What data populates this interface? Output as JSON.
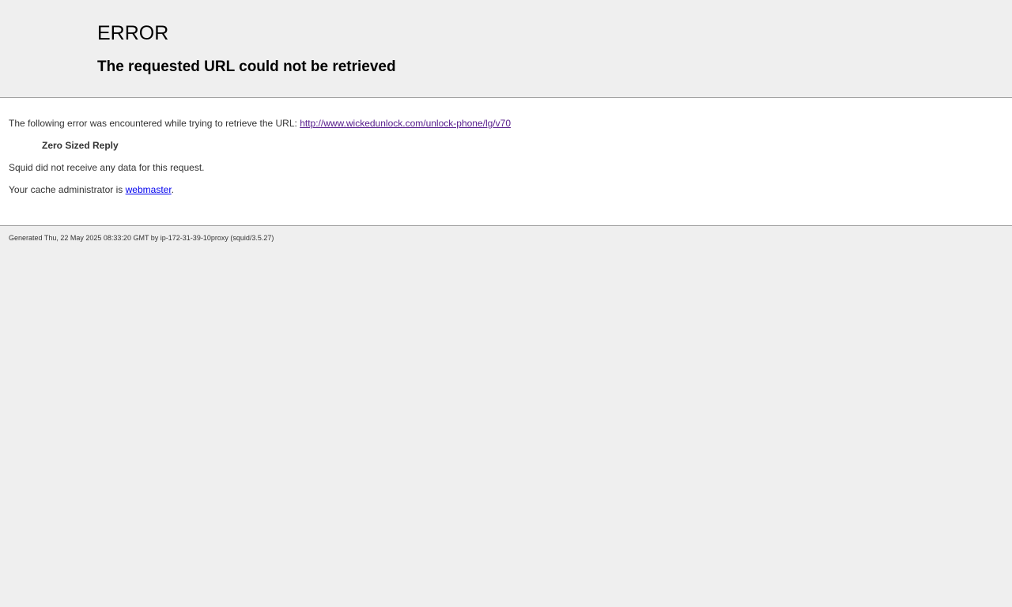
{
  "header": {
    "title": "ERROR",
    "subtitle": "The requested URL could not be retrieved"
  },
  "content": {
    "intro_text": "The following error was encountered while trying to retrieve the URL: ",
    "url": "http://www.wickedunlock.com/unlock-phone/lg/v70",
    "error_name": "Zero Sized Reply",
    "detail": "Squid did not receive any data for this request.",
    "admin_prefix": "Your cache administrator is ",
    "admin_link": "webmaster",
    "admin_suffix": "."
  },
  "footer": {
    "generated": "Generated Thu, 22 May 2025 08:33:20 GMT by ip-172-31-39-10proxy (squid/3.5.27)"
  },
  "colors": {
    "background": "#efefef",
    "content_background": "#ffffff",
    "visited_link": "#551a8b",
    "link": "#0000ee"
  }
}
